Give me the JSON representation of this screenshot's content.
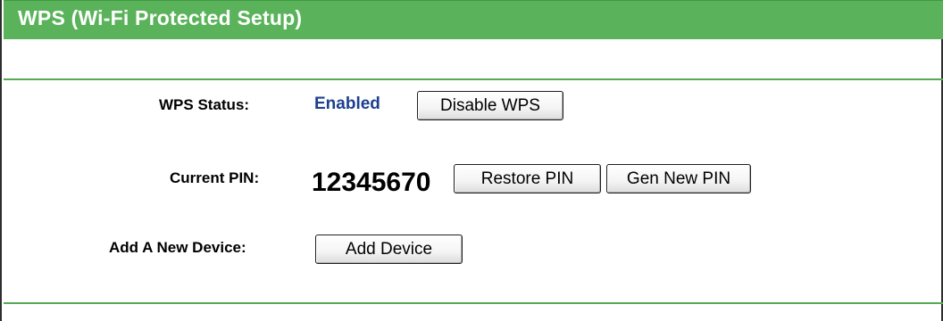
{
  "panel": {
    "title": "WPS (Wi-Fi Protected Setup)"
  },
  "wps_status": {
    "label": "WPS Status:",
    "value": "Enabled",
    "value_color": "#1c3f8f",
    "toggle_button": "Disable WPS"
  },
  "current_pin": {
    "label": "Current PIN:",
    "value": "12345670",
    "restore_button": "Restore PIN",
    "generate_button": "Gen New PIN"
  },
  "add_device": {
    "label": "Add A New Device:",
    "button": "Add Device"
  },
  "colors": {
    "header_green": "#5ab35a",
    "divider_green": "#55aa55",
    "header_text": "#ffffff"
  }
}
